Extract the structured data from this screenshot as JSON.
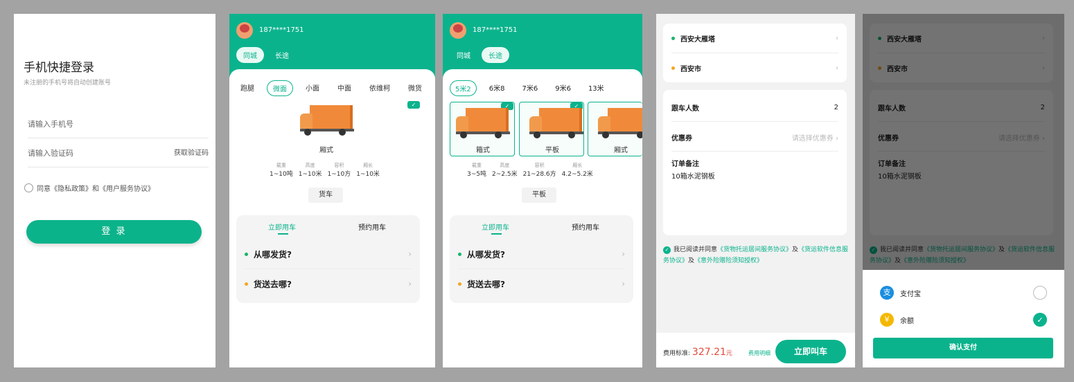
{
  "login": {
    "title": "手机快捷登录",
    "subtitle": "未注册的手机号将自动创建账号",
    "phone_placeholder": "请输入手机号",
    "code_placeholder": "请输入验证码",
    "get_code": "获取验证码",
    "agree_text": "同意《隐私政策》和《用户服务协议》",
    "login_button": "登 录"
  },
  "user": {
    "phone": "187****1751"
  },
  "header_tabs": [
    "同城",
    "长途"
  ],
  "vehicle_types": [
    "跑腿",
    "微面",
    "小面",
    "中面",
    "依维柯",
    "微货"
  ],
  "selected_vehicle": {
    "name": "厢式",
    "spec_keys": [
      "载重",
      "高度",
      "容积",
      "厢长"
    ],
    "spec_values": [
      "1~10吨",
      "1~10米",
      "1~10方",
      "1~10米"
    ],
    "category": "货车"
  },
  "sizes": [
    "5米2",
    "6米8",
    "7米6",
    "9米6",
    "13米"
  ],
  "truck_cards": [
    "箱式",
    "平板",
    "厢式"
  ],
  "long_vehicle": {
    "spec_keys": [
      "载重",
      "高度",
      "容积",
      "厢长"
    ],
    "spec_values": [
      "3~5吨",
      "2~2.5米",
      "21~28.6方",
      "4.2~5.2米"
    ],
    "category": "平板"
  },
  "booking": {
    "tabs": [
      "立即用车",
      "预约用车"
    ],
    "from": "从哪发货?",
    "to": "货送去哪?"
  },
  "order": {
    "from": "西安大雁塔",
    "to": "西安市",
    "riders_label": "跟车人数",
    "riders": "2",
    "coupon_label": "优惠券",
    "coupon_value": "请选择优惠券",
    "note_label": "订单备注",
    "note_value": "10箱水泥钢板",
    "terms_pre": "我已阅读并同意",
    "terms_link1": "《货物托运居间服务协议》",
    "terms_and1": "及",
    "terms_link2": "《货运软件信息服务协议》",
    "terms_and2": "及",
    "terms_link3": "《意外险赠险须知授权》",
    "price_label": "费用标准:",
    "price": "327.21",
    "price_unit": "元",
    "price_detail": "费用明细",
    "call_button": "立即叫车"
  },
  "payment": {
    "alipay": "支付宝",
    "balance": "余额",
    "confirm": "确认支付"
  },
  "colors": {
    "brand": "#0bb38d",
    "start_dot": "#1ab36b",
    "end_dot": "#f5a623",
    "price": "#e24a3b"
  }
}
